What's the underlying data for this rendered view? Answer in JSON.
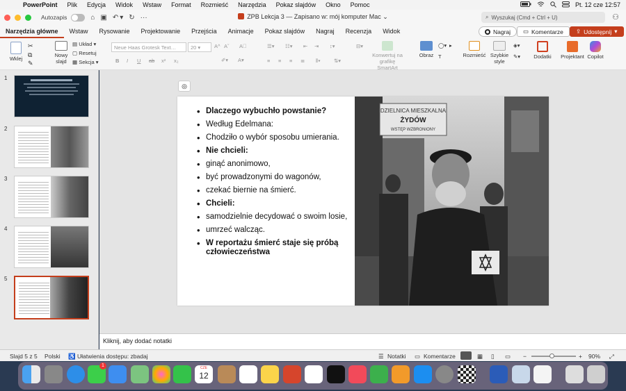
{
  "menubar": {
    "app": "PowerPoint",
    "items": [
      "Plik",
      "Edycja",
      "Widok",
      "Wstaw",
      "Format",
      "Rozmieść",
      "Narzędzia",
      "Pokaz slajdów",
      "Okno",
      "Pomoc"
    ],
    "datetime": "Pt. 12 cze  12:57"
  },
  "titlebar": {
    "autosave_label": "Autozapis",
    "doc_title": "ZPB Lekcja 3 — Zapisano w: mój komputer Mac",
    "search_placeholder": "Wyszukaj (Cmd + Ctrl + U)"
  },
  "tabs": [
    "Narzędzia główne",
    "Wstaw",
    "Rysowanie",
    "Projektowanie",
    "Przejścia",
    "Animacje",
    "Pokaz slajdów",
    "Nagraj",
    "Recenzja",
    "Widok"
  ],
  "tab_buttons": {
    "record": "Nagraj",
    "comments": "Komentarze",
    "share": "Udostępnij"
  },
  "ribbon": {
    "paste": "Wklej",
    "new_slide_1": "Nowy",
    "new_slide_2": "slajd",
    "layout": "Układ",
    "reset": "Resetuj",
    "section": "Sekcja",
    "font_name": "Neue Haas Grotesk Text…",
    "font_size": "20",
    "smartart_1": "Konwertuj na",
    "smartart_2": "grafikę SmartArt",
    "image": "Obraz",
    "arrange": "Rozmieść",
    "quick_styles_1": "Szybkie",
    "quick_styles_2": "style",
    "addins": "Dodatki",
    "designer": "Projektant",
    "copilot": "Copilot"
  },
  "thumbnails": [
    "1",
    "2",
    "3",
    "4",
    "5"
  ],
  "slide": {
    "bullets": [
      {
        "text": "Dlaczego wybuchło powstanie?",
        "bold": true
      },
      {
        "text": "Według Edelmana:",
        "bold": false
      },
      {
        "text": "Chodziło o wybór sposobu umierania.",
        "bold": false
      },
      {
        "text": "Nie chcieli:",
        "bold": true
      },
      {
        "text": "ginąć anonimowo,",
        "bold": false
      },
      {
        "text": "być prowadzonymi do wagonów,",
        "bold": false
      },
      {
        "text": "czekać biernie na śmierć.",
        "bold": false
      },
      {
        "text": "Chcieli:",
        "bold": true
      },
      {
        "text": "samodzielnie decydować o swoim losie,",
        "bold": false
      },
      {
        "text": "umrzeć walcząc.",
        "bold": false
      },
      {
        "text": "W reportażu śmierć staje się próbą człowieczeństwa",
        "bold": true
      }
    ],
    "photo_sign_1": "DZIELNICA MIESZKALNA",
    "photo_sign_2": "ŻYDÓW",
    "photo_sign_3": "WSTĘP WZBRONIONY"
  },
  "notes_placeholder": "Kliknij, aby dodać notatki",
  "status": {
    "slide_info": "Slajd 5 z 5",
    "language": "Polski",
    "accessibility": "Ułatwienia dostępu: zbadaj",
    "notes": "Notatki",
    "comments": "Komentarze",
    "zoom": "90%"
  },
  "dock": {
    "calendar_month": "CZE",
    "calendar_day": "12",
    "messages_badge": "1"
  }
}
